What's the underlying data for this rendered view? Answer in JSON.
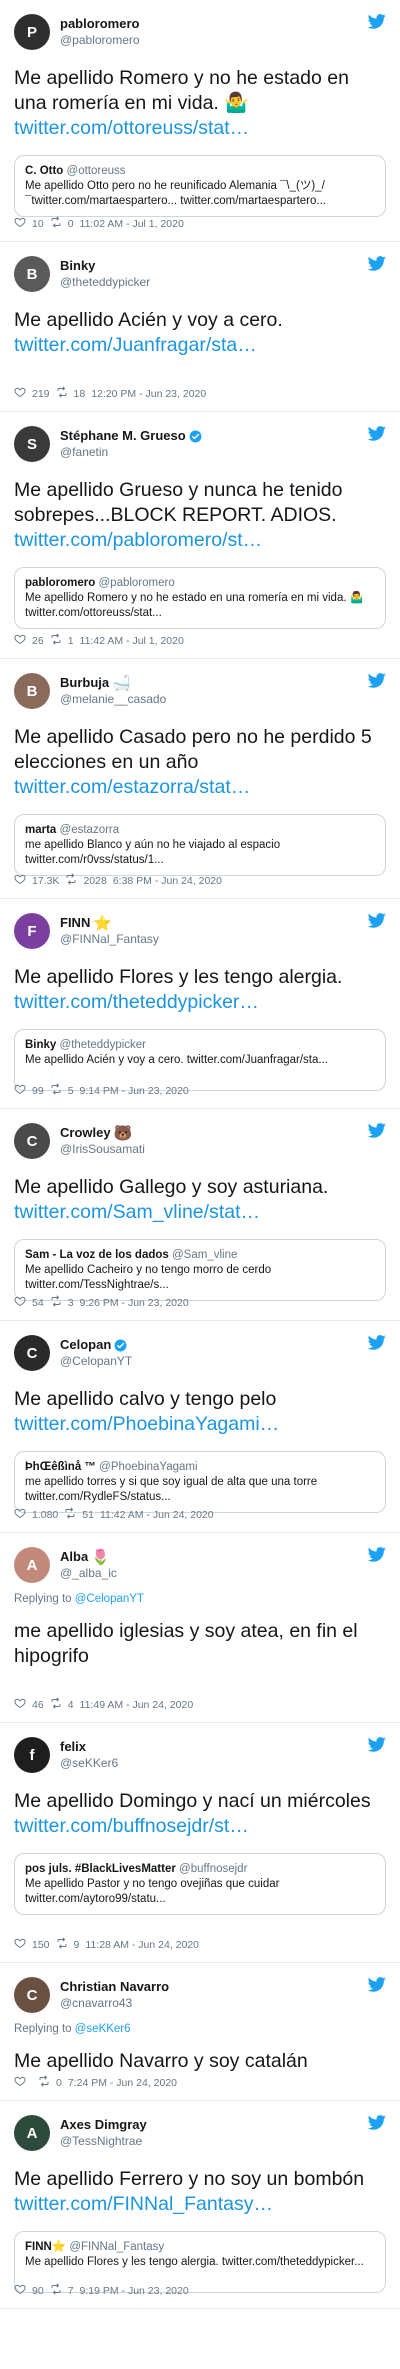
{
  "tweets": [
    {
      "name": "pabloromero",
      "handle": "@pabloromero",
      "verified": false,
      "name_emoji": "",
      "avatar_initial": "P",
      "avatar_color": "#2f2f2f",
      "reply_to": "",
      "text": "Me apellido Romero y no he estado en una romería en mi vida. 🤷‍♂️",
      "link": "twitter.com/ottoreuss/stat…",
      "quote": {
        "name": "C. Otto",
        "handle": "@ottoreuss",
        "line1": "Me apellido Otto pero no he reunificado Alemania ¯\\_(ツ)_/",
        "line2": "¯twitter.com/martaespartero... twitter.com/martaespartero..."
      },
      "likes": "10",
      "retweets": "0",
      "time": "11:02 AM - Jul 1, 2020"
    },
    {
      "name": "Binky",
      "handle": "@theteddypicker",
      "verified": false,
      "name_emoji": "",
      "avatar_initial": "B",
      "avatar_color": "#5a5a5a",
      "reply_to": "",
      "text": "Me apellido Acién y voy a cero.",
      "link": "twitter.com/Juanfragar/sta…",
      "quote": null,
      "likes": "219",
      "retweets": "18",
      "time": "12:20 PM - Jun 23, 2020"
    },
    {
      "name": "Stéphane M. Grueso",
      "handle": "@fanetin",
      "verified": true,
      "name_emoji": "",
      "avatar_initial": "S",
      "avatar_color": "#3a3a3a",
      "reply_to": "",
      "text": "Me apellido Grueso y nunca he tenido sobrepes...BLOCK REPORT. ADIOS.",
      "link": "twitter.com/pabloromero/st…",
      "quote": {
        "name": "pabloromero",
        "handle": "@pabloromero",
        "line1": "Me apellido Romero y no he estado en una romería en mi vida. 🤷‍♂️",
        "line2": "twitter.com/ottoreuss/stat..."
      },
      "likes": "26",
      "retweets": "1",
      "time": "11:42 AM - Jul 1, 2020"
    },
    {
      "name": "Burbuja",
      "handle": "@melanie__casado",
      "verified": false,
      "name_emoji": "🛁",
      "avatar_initial": "B",
      "avatar_color": "#8a6a5a",
      "reply_to": "",
      "text": "Me apellido Casado pero no he perdido 5 elecciones en un año",
      "link": "twitter.com/estazorra/stat…",
      "quote": {
        "name": "marta",
        "handle": "@estazorra",
        "line1": "me apellido Blanco y aún no he viajado al espacio",
        "line2": "twitter.com/r0vss/status/1..."
      },
      "likes": "17.3K",
      "retweets": "2028",
      "time": "6:38 PM - Jun 24, 2020"
    },
    {
      "name": "FINN",
      "handle": "@FINNal_Fantasy",
      "verified": false,
      "name_emoji": "⭐",
      "avatar_initial": "F",
      "avatar_color": "#7b3fa0",
      "reply_to": "",
      "text": "Me apellido Flores y les tengo alergia.",
      "link": "twitter.com/theteddypicker…",
      "quote": {
        "name": "Binky",
        "handle": "@theteddypicker",
        "line1": "Me apellido Acién y voy a cero. twitter.com/Juanfragar/sta...",
        "line2": ""
      },
      "likes": "99",
      "retweets": "5",
      "time": "9:14 PM - Jun 23, 2020"
    },
    {
      "name": "Crowley",
      "handle": "@IrisSousamati",
      "verified": false,
      "name_emoji": "🐻",
      "avatar_initial": "C",
      "avatar_color": "#4a4a4a",
      "reply_to": "",
      "text": "Me apellido Gallego y soy asturiana.",
      "link": "twitter.com/Sam_vline/stat…",
      "quote": {
        "name": "Sam - La voz de los dados",
        "handle": "@Sam_vline",
        "line1": "Me apellido Cacheiro y no tengo morro de cerdo",
        "line2": "twitter.com/TessNightrae/s..."
      },
      "likes": "54",
      "retweets": "3",
      "time": "9:26 PM - Jun 23, 2020"
    },
    {
      "name": "Celopan",
      "handle": "@CelopanYT",
      "verified": true,
      "name_emoji": "",
      "avatar_initial": "C",
      "avatar_color": "#2a2a2a",
      "reply_to": "",
      "text": "Me apellido calvo y tengo pelo",
      "link": "twitter.com/PhoebinaYagami…",
      "quote": {
        "name": "ÞhŒêßìnå ™",
        "handle": "@PhoebinaYagami",
        "line1": "me apellido torres y si que soy igual de alta que una torre",
        "line2": "twitter.com/RydleFS/status..."
      },
      "likes": "1.080",
      "retweets": "51",
      "time": "11:42 AM - Jun 24, 2020"
    },
    {
      "name": "Alba",
      "handle": "@_alba_ic",
      "verified": false,
      "name_emoji": "🌷",
      "avatar_initial": "A",
      "avatar_color": "#c28a7a",
      "reply_to": "@CelopanYT",
      "text": "me apellido iglesias y soy atea, en fin el hipogrifo",
      "link": "",
      "quote": null,
      "likes": "46",
      "retweets": "4",
      "time": "11:49 AM - Jun 24, 2020"
    },
    {
      "name": "felix",
      "handle": "@seKKer6",
      "verified": false,
      "name_emoji": "",
      "avatar_initial": "f",
      "avatar_color": "#1e1e1e",
      "reply_to": "",
      "text": "Me apellido Domingo y nací un miércoles",
      "link": "twitter.com/buffnosejdr/st…",
      "quote": {
        "name": "pos juls. #BlackLivesMatter",
        "handle": "@buffnosejdr",
        "line1": "Me apellido Pastor y no tengo ovejiñas que cuidar",
        "line2": "twitter.com/aytoro99/statu..."
      },
      "likes": "150",
      "retweets": "9",
      "time": "11:28 AM - Jun 24, 2020"
    },
    {
      "name": "Christian Navarro",
      "handle": "@cnavarro43",
      "verified": false,
      "name_emoji": "",
      "avatar_initial": "C",
      "avatar_color": "#6a5040",
      "reply_to": "@seKKer6",
      "text": "Me apellido Navarro y soy catalán",
      "link": "",
      "quote": null,
      "likes": "",
      "retweets": "0",
      "time": "7:24 PM - Jun 24, 2020"
    },
    {
      "name": "Axes Dimgray",
      "handle": "@TessNightrae",
      "verified": false,
      "name_emoji": "",
      "avatar_initial": "A",
      "avatar_color": "#2e4a3a",
      "reply_to": "",
      "text": "Me apellido Ferrero y no soy un bombón",
      "link": "twitter.com/FINNal_Fantasy…",
      "quote": {
        "name": "FINN⭐",
        "handle": "@FINNal_Fantasy",
        "line1": "Me apellido Flores y les tengo alergia. twitter.com/theteddypicker...",
        "line2": ""
      },
      "likes": "90",
      "retweets": "7",
      "time": "9:19 PM - Jun 23, 2020"
    }
  ],
  "labels": {
    "replying_to": "Replying to"
  },
  "colors": {
    "accent": "#1da1f2",
    "link": "#1b95e0",
    "muted": "#657786",
    "like_red": "#e0245e"
  },
  "icons": {
    "logo": "twitter-bird-icon",
    "verified": "verified-badge-icon",
    "like": "heart-icon",
    "retweet": "retweet-icon"
  }
}
